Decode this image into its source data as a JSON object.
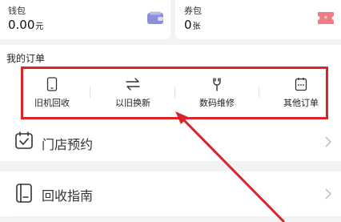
{
  "wallet": {
    "title": "钱包",
    "value": "0.00",
    "unit": "元",
    "icon": "wallet-icon",
    "icon_color": "#8a8fdc"
  },
  "coupon": {
    "title": "券包",
    "value": "0",
    "unit": "张",
    "icon": "ticket-icon",
    "icon_color": "#f07b87"
  },
  "orders": {
    "title": "我的订单",
    "items": [
      {
        "label": "旧机回收",
        "icon": "phone-icon"
      },
      {
        "label": "以旧换新",
        "icon": "exchange-arrows-icon"
      },
      {
        "label": "数码维修",
        "icon": "wrench-icon"
      },
      {
        "label": "其他订单",
        "icon": "more-orders-icon"
      }
    ]
  },
  "menu": [
    {
      "label": "门店预约",
      "icon": "calendar-check-icon"
    },
    {
      "label": "回收指南",
      "icon": "guide-book-icon"
    }
  ],
  "annotation": {
    "highlight_color": "#d9252a"
  }
}
